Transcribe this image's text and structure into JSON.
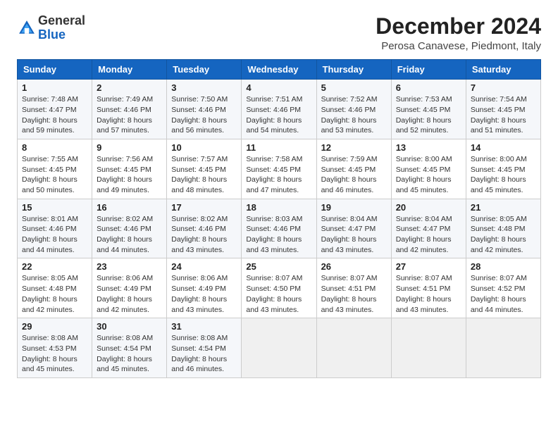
{
  "logo": {
    "general": "General",
    "blue": "Blue"
  },
  "title": "December 2024",
  "location": "Perosa Canavese, Piedmont, Italy",
  "header": {
    "days": [
      "Sunday",
      "Monday",
      "Tuesday",
      "Wednesday",
      "Thursday",
      "Friday",
      "Saturday"
    ]
  },
  "weeks": [
    [
      {
        "day": "1",
        "sunrise": "Sunrise: 7:48 AM",
        "sunset": "Sunset: 4:47 PM",
        "daylight": "Daylight: 8 hours and 59 minutes."
      },
      {
        "day": "2",
        "sunrise": "Sunrise: 7:49 AM",
        "sunset": "Sunset: 4:46 PM",
        "daylight": "Daylight: 8 hours and 57 minutes."
      },
      {
        "day": "3",
        "sunrise": "Sunrise: 7:50 AM",
        "sunset": "Sunset: 4:46 PM",
        "daylight": "Daylight: 8 hours and 56 minutes."
      },
      {
        "day": "4",
        "sunrise": "Sunrise: 7:51 AM",
        "sunset": "Sunset: 4:46 PM",
        "daylight": "Daylight: 8 hours and 54 minutes."
      },
      {
        "day": "5",
        "sunrise": "Sunrise: 7:52 AM",
        "sunset": "Sunset: 4:46 PM",
        "daylight": "Daylight: 8 hours and 53 minutes."
      },
      {
        "day": "6",
        "sunrise": "Sunrise: 7:53 AM",
        "sunset": "Sunset: 4:45 PM",
        "daylight": "Daylight: 8 hours and 52 minutes."
      },
      {
        "day": "7",
        "sunrise": "Sunrise: 7:54 AM",
        "sunset": "Sunset: 4:45 PM",
        "daylight": "Daylight: 8 hours and 51 minutes."
      }
    ],
    [
      {
        "day": "8",
        "sunrise": "Sunrise: 7:55 AM",
        "sunset": "Sunset: 4:45 PM",
        "daylight": "Daylight: 8 hours and 50 minutes."
      },
      {
        "day": "9",
        "sunrise": "Sunrise: 7:56 AM",
        "sunset": "Sunset: 4:45 PM",
        "daylight": "Daylight: 8 hours and 49 minutes."
      },
      {
        "day": "10",
        "sunrise": "Sunrise: 7:57 AM",
        "sunset": "Sunset: 4:45 PM",
        "daylight": "Daylight: 8 hours and 48 minutes."
      },
      {
        "day": "11",
        "sunrise": "Sunrise: 7:58 AM",
        "sunset": "Sunset: 4:45 PM",
        "daylight": "Daylight: 8 hours and 47 minutes."
      },
      {
        "day": "12",
        "sunrise": "Sunrise: 7:59 AM",
        "sunset": "Sunset: 4:45 PM",
        "daylight": "Daylight: 8 hours and 46 minutes."
      },
      {
        "day": "13",
        "sunrise": "Sunrise: 8:00 AM",
        "sunset": "Sunset: 4:45 PM",
        "daylight": "Daylight: 8 hours and 45 minutes."
      },
      {
        "day": "14",
        "sunrise": "Sunrise: 8:00 AM",
        "sunset": "Sunset: 4:45 PM",
        "daylight": "Daylight: 8 hours and 45 minutes."
      }
    ],
    [
      {
        "day": "15",
        "sunrise": "Sunrise: 8:01 AM",
        "sunset": "Sunset: 4:46 PM",
        "daylight": "Daylight: 8 hours and 44 minutes."
      },
      {
        "day": "16",
        "sunrise": "Sunrise: 8:02 AM",
        "sunset": "Sunset: 4:46 PM",
        "daylight": "Daylight: 8 hours and 44 minutes."
      },
      {
        "day": "17",
        "sunrise": "Sunrise: 8:02 AM",
        "sunset": "Sunset: 4:46 PM",
        "daylight": "Daylight: 8 hours and 43 minutes."
      },
      {
        "day": "18",
        "sunrise": "Sunrise: 8:03 AM",
        "sunset": "Sunset: 4:46 PM",
        "daylight": "Daylight: 8 hours and 43 minutes."
      },
      {
        "day": "19",
        "sunrise": "Sunrise: 8:04 AM",
        "sunset": "Sunset: 4:47 PM",
        "daylight": "Daylight: 8 hours and 43 minutes."
      },
      {
        "day": "20",
        "sunrise": "Sunrise: 8:04 AM",
        "sunset": "Sunset: 4:47 PM",
        "daylight": "Daylight: 8 hours and 42 minutes."
      },
      {
        "day": "21",
        "sunrise": "Sunrise: 8:05 AM",
        "sunset": "Sunset: 4:48 PM",
        "daylight": "Daylight: 8 hours and 42 minutes."
      }
    ],
    [
      {
        "day": "22",
        "sunrise": "Sunrise: 8:05 AM",
        "sunset": "Sunset: 4:48 PM",
        "daylight": "Daylight: 8 hours and 42 minutes."
      },
      {
        "day": "23",
        "sunrise": "Sunrise: 8:06 AM",
        "sunset": "Sunset: 4:49 PM",
        "daylight": "Daylight: 8 hours and 42 minutes."
      },
      {
        "day": "24",
        "sunrise": "Sunrise: 8:06 AM",
        "sunset": "Sunset: 4:49 PM",
        "daylight": "Daylight: 8 hours and 43 minutes."
      },
      {
        "day": "25",
        "sunrise": "Sunrise: 8:07 AM",
        "sunset": "Sunset: 4:50 PM",
        "daylight": "Daylight: 8 hours and 43 minutes."
      },
      {
        "day": "26",
        "sunrise": "Sunrise: 8:07 AM",
        "sunset": "Sunset: 4:51 PM",
        "daylight": "Daylight: 8 hours and 43 minutes."
      },
      {
        "day": "27",
        "sunrise": "Sunrise: 8:07 AM",
        "sunset": "Sunset: 4:51 PM",
        "daylight": "Daylight: 8 hours and 43 minutes."
      },
      {
        "day": "28",
        "sunrise": "Sunrise: 8:07 AM",
        "sunset": "Sunset: 4:52 PM",
        "daylight": "Daylight: 8 hours and 44 minutes."
      }
    ],
    [
      {
        "day": "29",
        "sunrise": "Sunrise: 8:08 AM",
        "sunset": "Sunset: 4:53 PM",
        "daylight": "Daylight: 8 hours and 45 minutes."
      },
      {
        "day": "30",
        "sunrise": "Sunrise: 8:08 AM",
        "sunset": "Sunset: 4:54 PM",
        "daylight": "Daylight: 8 hours and 45 minutes."
      },
      {
        "day": "31",
        "sunrise": "Sunrise: 8:08 AM",
        "sunset": "Sunset: 4:54 PM",
        "daylight": "Daylight: 8 hours and 46 minutes."
      },
      null,
      null,
      null,
      null
    ]
  ]
}
